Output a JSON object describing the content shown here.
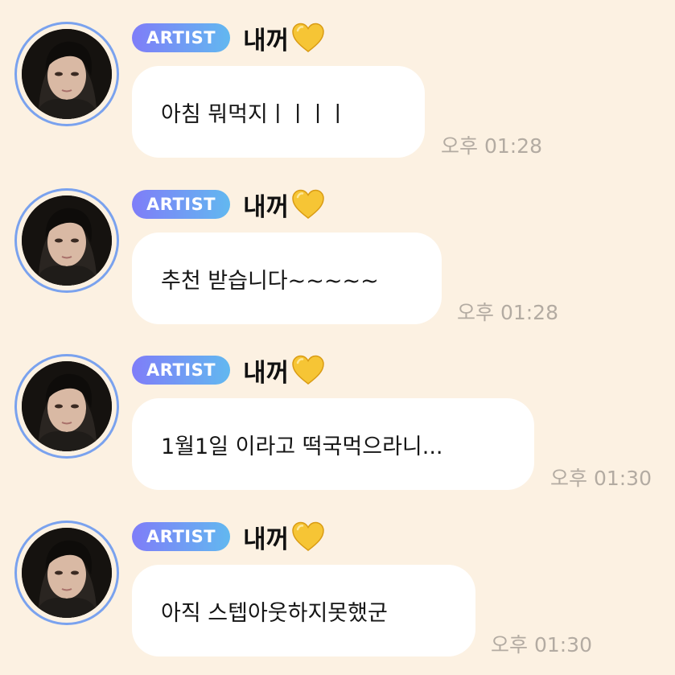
{
  "colors": {
    "background": "#fcf1e2",
    "bubble": "#ffffff",
    "badge_gradient_start": "#7f7df8",
    "badge_gradient_end": "#62b8f0",
    "avatar_ring": "#7aa2ee",
    "timestamp": "#b3aba2",
    "heart": "#f4c430"
  },
  "messages": [
    {
      "badge": "ARTIST",
      "nickname": "내꺼",
      "nickname_icon": "yellow-heart-icon",
      "text": "아침 뭐먹지ㅣㅣㅣㅣ",
      "time": "오후 01:28"
    },
    {
      "badge": "ARTIST",
      "nickname": "내꺼",
      "nickname_icon": "yellow-heart-icon",
      "text": "추천 받습니다~~~~~",
      "time": "오후 01:28"
    },
    {
      "badge": "ARTIST",
      "nickname": "내꺼",
      "nickname_icon": "yellow-heart-icon",
      "text": "1월1일 이라고 떡국먹으라니...",
      "time": "오후 01:30"
    },
    {
      "badge": "ARTIST",
      "nickname": "내꺼",
      "nickname_icon": "yellow-heart-icon",
      "text": "아직 스텝아웃하지못했군",
      "time": "오후 01:30"
    }
  ]
}
